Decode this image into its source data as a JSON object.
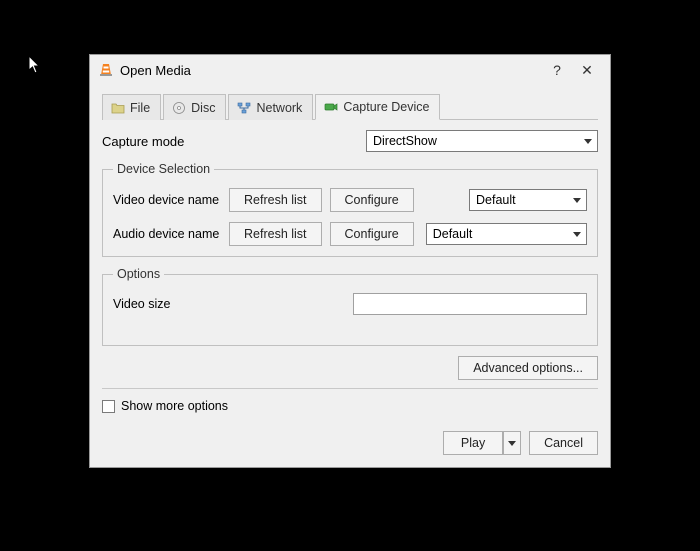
{
  "window": {
    "title": "Open Media",
    "help_label": "?",
    "close_label": "✕"
  },
  "tabs": {
    "file": "File",
    "disc": "Disc",
    "network": "Network",
    "capture": "Capture Device"
  },
  "capture_mode": {
    "label": "Capture mode",
    "value": "DirectShow"
  },
  "device_selection": {
    "legend": "Device Selection",
    "video_label": "Video device name",
    "audio_label": "Audio device name",
    "refresh_label": "Refresh list",
    "configure_label": "Configure",
    "video_value": "Default",
    "audio_value": "Default"
  },
  "options": {
    "legend": "Options",
    "video_size_label": "Video size",
    "video_size_value": ""
  },
  "advanced_label": "Advanced options...",
  "show_more_label": "Show more options",
  "buttons": {
    "play": "Play",
    "cancel": "Cancel"
  }
}
